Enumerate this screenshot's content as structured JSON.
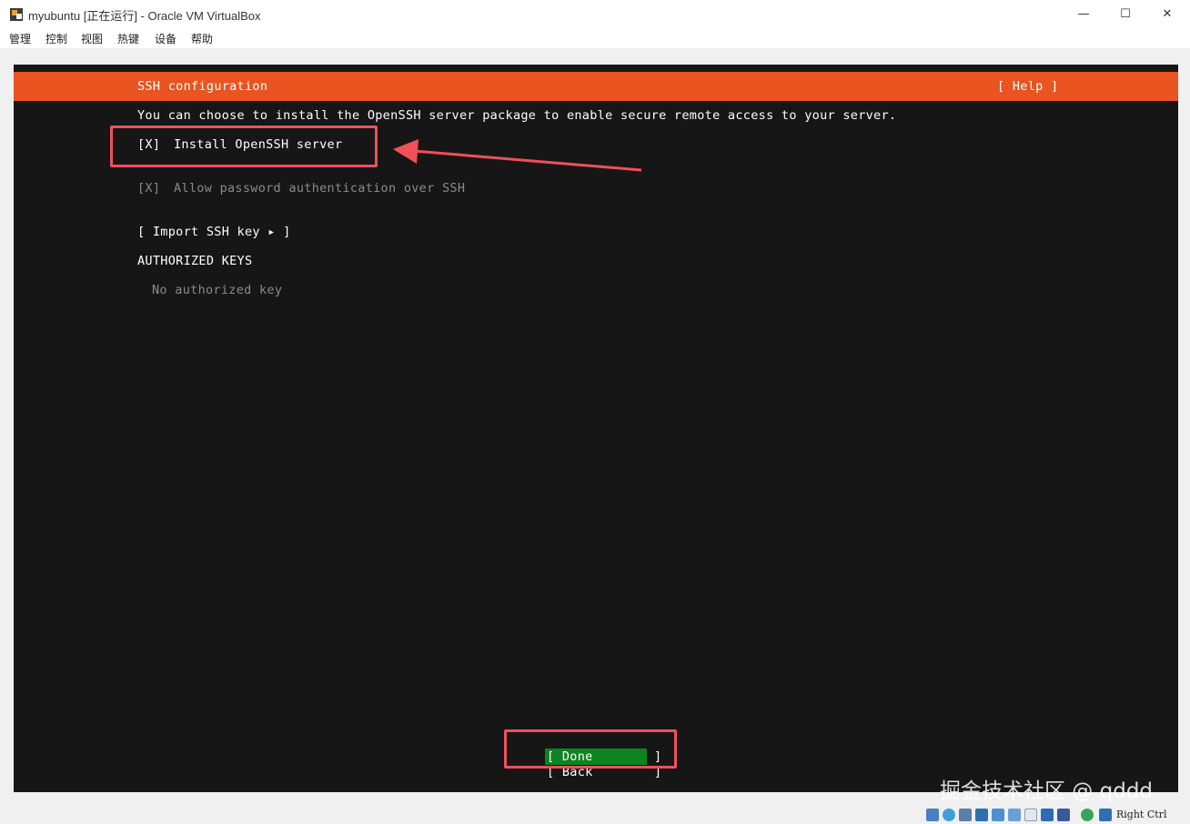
{
  "window": {
    "title": "myubuntu [正在运行] - Oracle VM VirtualBox",
    "minimize_glyph": "—",
    "maximize_glyph": "☐",
    "close_glyph": "✕"
  },
  "menu": {
    "items": [
      {
        "label": "管理"
      },
      {
        "label": "控制"
      },
      {
        "label": "视图"
      },
      {
        "label": "热键"
      },
      {
        "label": "设备"
      },
      {
        "label": "帮助"
      }
    ]
  },
  "installer": {
    "header_title": "SSH configuration",
    "help_label": "[ Help ]",
    "description": "You can choose to install the OpenSSH server package to enable secure remote access to your server.",
    "install_ssh_checkbox": "[X]",
    "install_ssh_label": "Install OpenSSH server",
    "allow_password_checkbox": "[X]",
    "allow_password_label": "Allow password authentication over SSH",
    "import_key_label": "[ Import SSH key ▸ ]",
    "authorized_keys_heading": "AUTHORIZED KEYS",
    "no_keys_text": "No authorized key",
    "done_label": "[ Done        ]",
    "back_label": "[ Back        ]"
  },
  "colors": {
    "ubuntu_orange": "#e95420",
    "terminal_bg": "#161616",
    "done_green": "#0e8420",
    "annotation_red": "#f0505a"
  },
  "watermark": "掘金技术社区 @ qddd",
  "statusbar": {
    "host_key": "Right Ctrl",
    "icons": [
      "hard-disk-icon",
      "optical-drive-icon",
      "audio-icon",
      "network-icon",
      "usb-icon",
      "shared-folders-icon",
      "display-icon",
      "video-capture-icon",
      "virtualization-icon",
      "mouse-integration-icon",
      "host-key-icon"
    ]
  }
}
